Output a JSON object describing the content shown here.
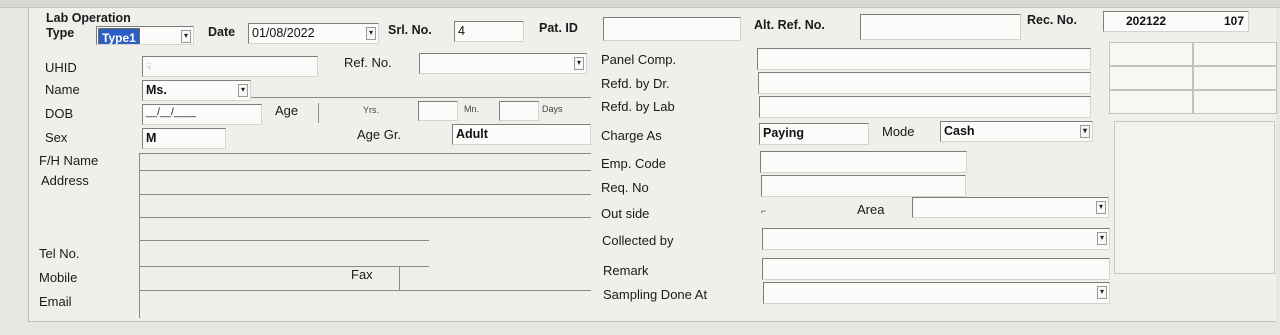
{
  "header": {
    "lab_operation_label": "Lab Operation",
    "type_label": "Type",
    "type_value": "Type1",
    "date_label": "Date",
    "date_value": "01/08/2022",
    "srl_no_label": "Srl. No.",
    "srl_no_value": "4",
    "pat_id_label": "Pat. ID",
    "pat_id_value": "",
    "alt_ref_label": "Alt. Ref. No.",
    "alt_ref_value": "",
    "rec_no_label": "Rec. No.",
    "rec_no_value": "202122",
    "rec_no_seq": "107"
  },
  "left": {
    "uhid_label": "UHID",
    "ref_no_label": "Ref. No.",
    "name_label": "Name",
    "name_prefix": "Ms.",
    "dob_label": "DOB",
    "dob_value": "__/__/____",
    "age_label": "Age",
    "yrs_label": "Yrs.",
    "mn_label": "Mn.",
    "days_label": "Days",
    "sex_label": "Sex",
    "sex_value": "M",
    "age_group_label": "Age Gr.",
    "age_group_value": "Adult",
    "fh_name_label": "F/H Name",
    "address_label": "Address",
    "tel_label": "Tel No.",
    "mobile_label": "Mobile",
    "fax_label": "Fax",
    "email_label": "Email"
  },
  "middle": {
    "panel_comp_label": "Panel Comp.",
    "refd_dr_label": "Refd. by Dr.",
    "refd_lab_label": "Refd. by Lab",
    "charge_as_label": "Charge As",
    "charge_as_value": "Paying",
    "mode_label": "Mode",
    "mode_value": "Cash",
    "emp_code_label": "Emp. Code",
    "req_no_label": "Req. No",
    "outside_label": "Out side",
    "area_label": "Area",
    "collected_by_label": "Collected by",
    "remark_label": "Remark",
    "sampling_label": "Sampling Done At"
  },
  "colors": {
    "background": "#efefeb",
    "selection": "#2d5ec4"
  },
  "icons": {
    "dropdown": "triangle-down",
    "cursor": "pointer-cursor"
  }
}
